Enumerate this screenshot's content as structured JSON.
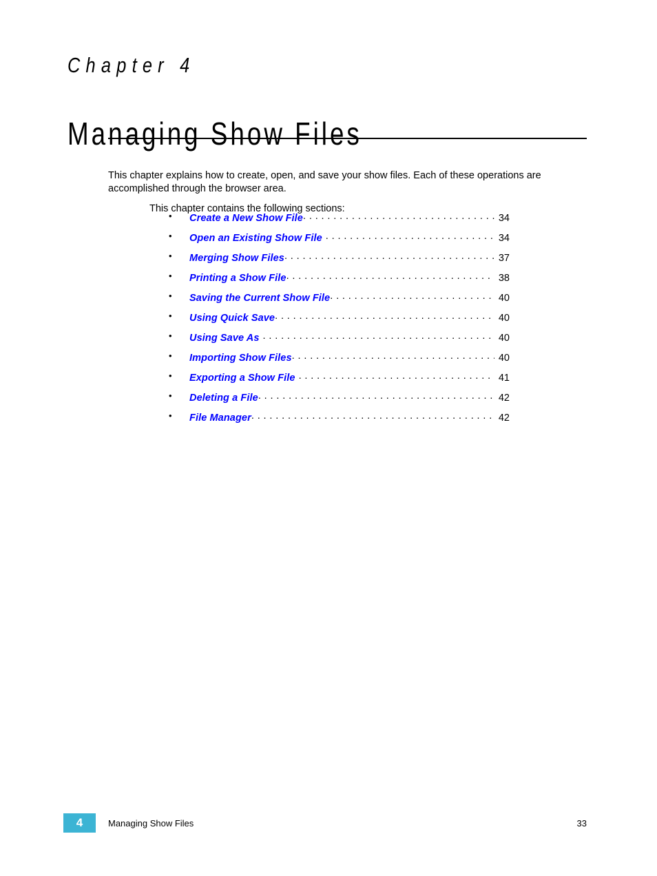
{
  "document": {
    "chapter_eyebrow": "Chapter 4",
    "chapter_title": "Managing Show Files",
    "intro_paragraph": "This chapter explains how to create, open, and save your show files. Each of these operations are accomplished through the browser area.",
    "intro_subparagraph": "This chapter contains the following sections:",
    "bullet_glyph": "•",
    "link_color": "#0000ff",
    "accent_color": "#3cb4d4"
  },
  "toc": {
    "entries": [
      {
        "label": "Create a New Show File",
        "page": "34",
        "trailing_space": false
      },
      {
        "label": "Open an Existing Show File",
        "page": "34",
        "trailing_space": true
      },
      {
        "label": "Merging Show Files",
        "page": "37",
        "trailing_space": false
      },
      {
        "label": "Printing a Show File",
        "page": "38",
        "trailing_space": false
      },
      {
        "label": "Saving the Current Show File",
        "page": "40",
        "trailing_space": false
      },
      {
        "label": "Using Quick Save",
        "page": "40",
        "trailing_space": false
      },
      {
        "label": "Using Save As",
        "page": "40",
        "trailing_space": true
      },
      {
        "label": "Importing Show Files",
        "page": "40",
        "trailing_space": false
      },
      {
        "label": "Exporting a Show File",
        "page": "41",
        "trailing_space": true
      },
      {
        "label": "Deleting a File",
        "page": "42",
        "trailing_space": false
      },
      {
        "label": "File Manager",
        "page": "42",
        "trailing_space": false
      }
    ]
  },
  "footer": {
    "chapter_number": "4",
    "chapter_name": "Managing Show Files",
    "page_number": "33"
  }
}
